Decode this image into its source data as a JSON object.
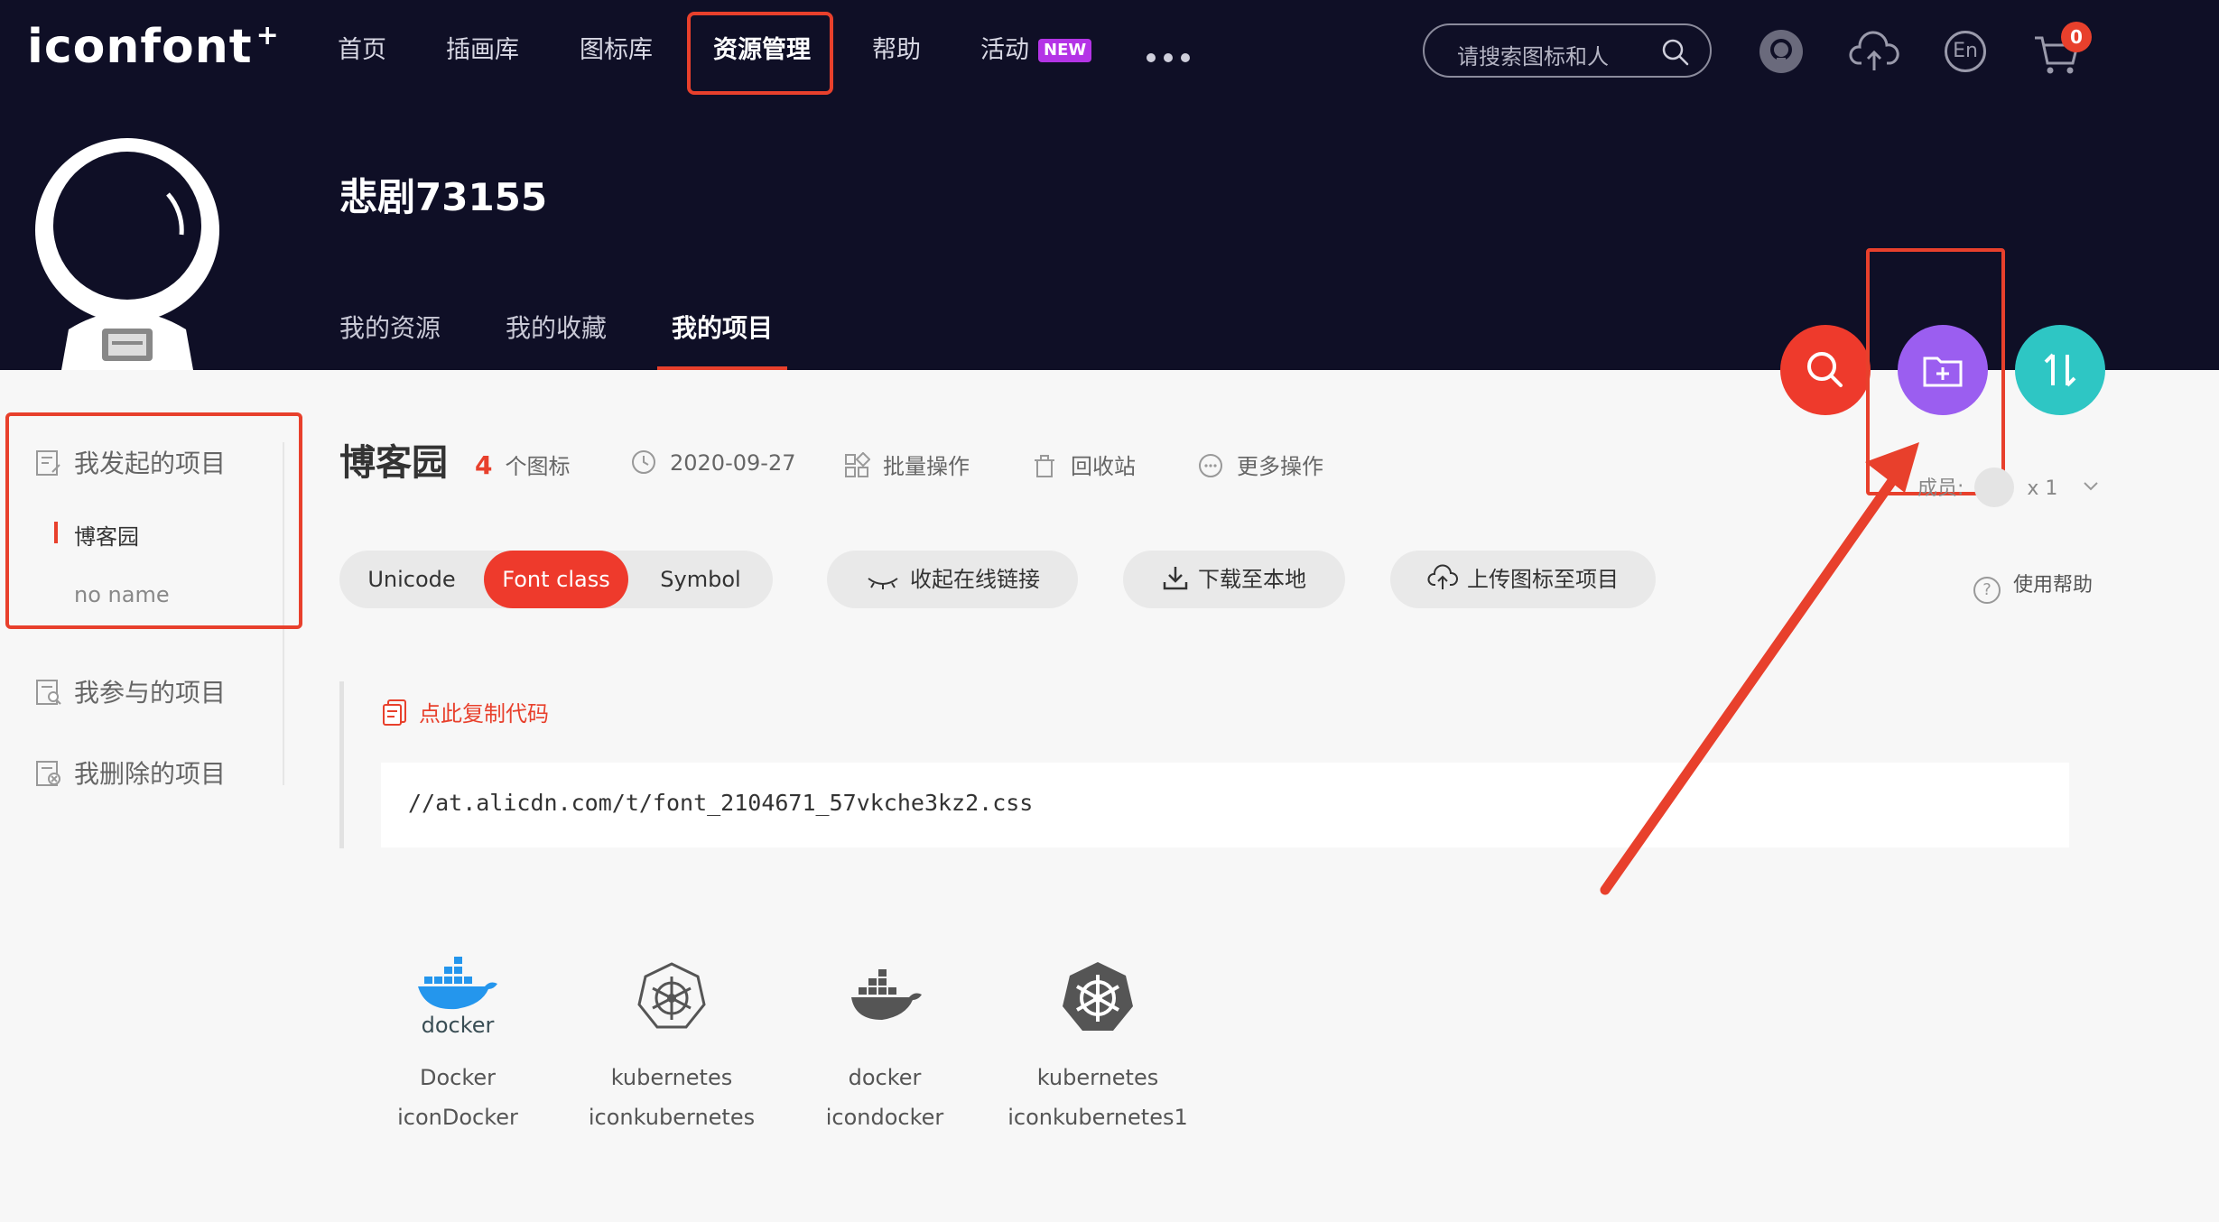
{
  "header": {
    "logo": "iconfont",
    "logo_plus": "+",
    "nav": [
      {
        "label": "首页"
      },
      {
        "label": "插画库"
      },
      {
        "label": "图标库"
      },
      {
        "label": "资源管理",
        "active": true
      },
      {
        "label": "帮助"
      },
      {
        "label": "活动",
        "badge": "NEW"
      }
    ],
    "search_placeholder": "请搜索图标和人",
    "lang_label": "En",
    "cart_count": "0"
  },
  "profile": {
    "username": "悲剧73155",
    "tabs": [
      {
        "label": "我的资源"
      },
      {
        "label": "我的收藏"
      },
      {
        "label": "我的项目",
        "active": true
      }
    ]
  },
  "sidebar": {
    "initiated": {
      "label": "我发起的项目",
      "projects": [
        {
          "label": "博客园",
          "active": true
        },
        {
          "label": "no name"
        }
      ]
    },
    "joined": "我参与的项目",
    "deleted": "我删除的项目"
  },
  "project": {
    "title": "博客园",
    "icon_count": "4",
    "icon_count_unit": "个图标",
    "date": "2020-09-27",
    "batch": "批量操作",
    "recycle": "回收站",
    "more": "更多操作",
    "members_label": "成员:",
    "members_count": "x 1"
  },
  "toolbar": {
    "modes": [
      "Unicode",
      "Font class",
      "Symbol"
    ],
    "active_mode": "Font class",
    "collapse_link": "收起在线链接",
    "download": "下载至本地",
    "upload": "上传图标至项目",
    "help": "使用帮助"
  },
  "code": {
    "copy_label": "点此复制代码",
    "url": "//at.alicdn.com/t/font_2104671_57vkche3kz2.css"
  },
  "icons": [
    {
      "name": "Docker",
      "class": "iconDocker",
      "icon": "docker-logo-icon"
    },
    {
      "name": "kubernetes",
      "class": "iconkubernetes",
      "icon": "kubernetes-outline-icon"
    },
    {
      "name": "docker",
      "class": "icondocker",
      "icon": "docker-whale-icon"
    },
    {
      "name": "kubernetes",
      "class": "iconkubernetes1",
      "icon": "kubernetes-filled-icon"
    }
  ],
  "colors": {
    "header_bg": "#0f0f26",
    "accent_red": "#ee3a2c",
    "fab_purple": "#9b5ef0",
    "fab_teal": "#2ec6c4",
    "annotation": "#e8402c"
  }
}
